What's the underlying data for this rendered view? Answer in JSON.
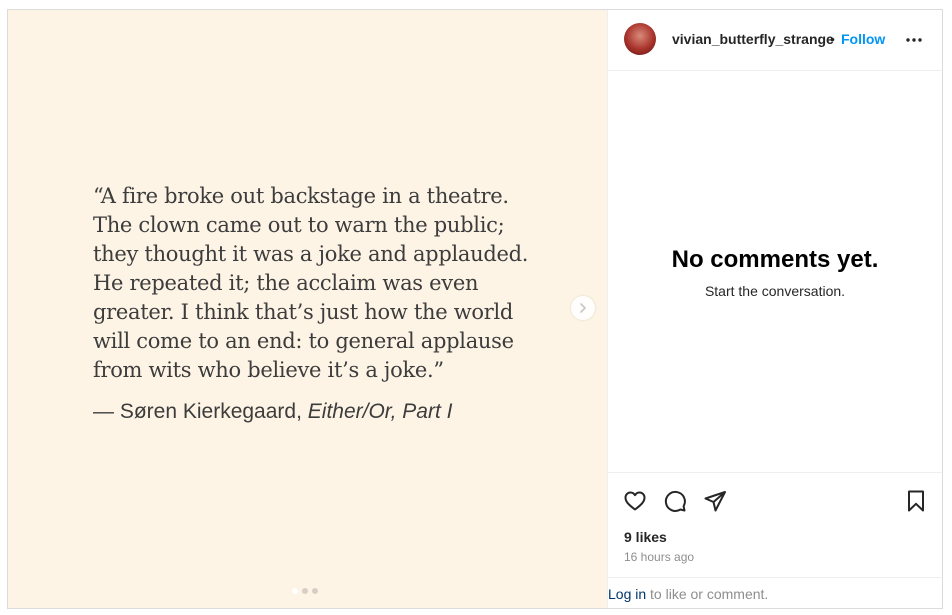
{
  "post": {
    "quote_text": "“A fire broke out backstage in a theatre.\nThe clown came out to warn the public;\nthey thought it was a joke and applauded.\nHe repeated it; the acclaim was even\ngreater. I think that’s just how the world\nwill come to an end: to general applause\nfrom wits who believe it’s a joke.”",
    "attribution_author": "— Søren Kierkegaard, ",
    "attribution_work": "Either/Or, Part I",
    "carousel_slide_count": 3,
    "carousel_active_index": 0,
    "background_color": "#fdf4e6"
  },
  "header": {
    "username": "vivian_butterfly_strange",
    "separator": "•",
    "follow_label": "Follow"
  },
  "comments": {
    "empty_title": "No comments yet.",
    "empty_subtitle": "Start the conversation."
  },
  "footer": {
    "likes": "9 likes",
    "timestamp": "16 hours ago",
    "login_link": "Log in",
    "login_suffix": " to like or comment."
  },
  "icons": {
    "like": "heart-icon",
    "comment": "comment-icon",
    "share": "share-icon",
    "save": "bookmark-icon",
    "more": "more-options-icon",
    "next": "chevron-right-icon"
  },
  "colors": {
    "accent": "#0095f6",
    "link": "#00376b",
    "muted": "#8e8e8e"
  }
}
